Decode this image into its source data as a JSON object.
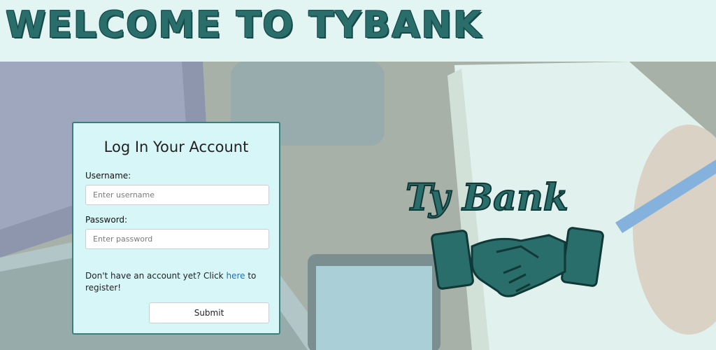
{
  "header": {
    "title": "WELCOME TO TYBANK"
  },
  "login": {
    "title": "Log In Your Account",
    "username_label": "Username:",
    "username_placeholder": "Enter username",
    "password_label": "Password:",
    "password_placeholder": "Enter password",
    "register_prefix": "Don't have an account yet? Click ",
    "register_link": "here",
    "register_suffix": " to register!",
    "submit_label": "Submit"
  },
  "logo": {
    "icon": "handshake-icon",
    "brand_color": "#2a6e6b"
  },
  "colors": {
    "accent": "#2a6e6b",
    "card_bg": "#d6f6f7",
    "link": "#1f6fc2"
  }
}
